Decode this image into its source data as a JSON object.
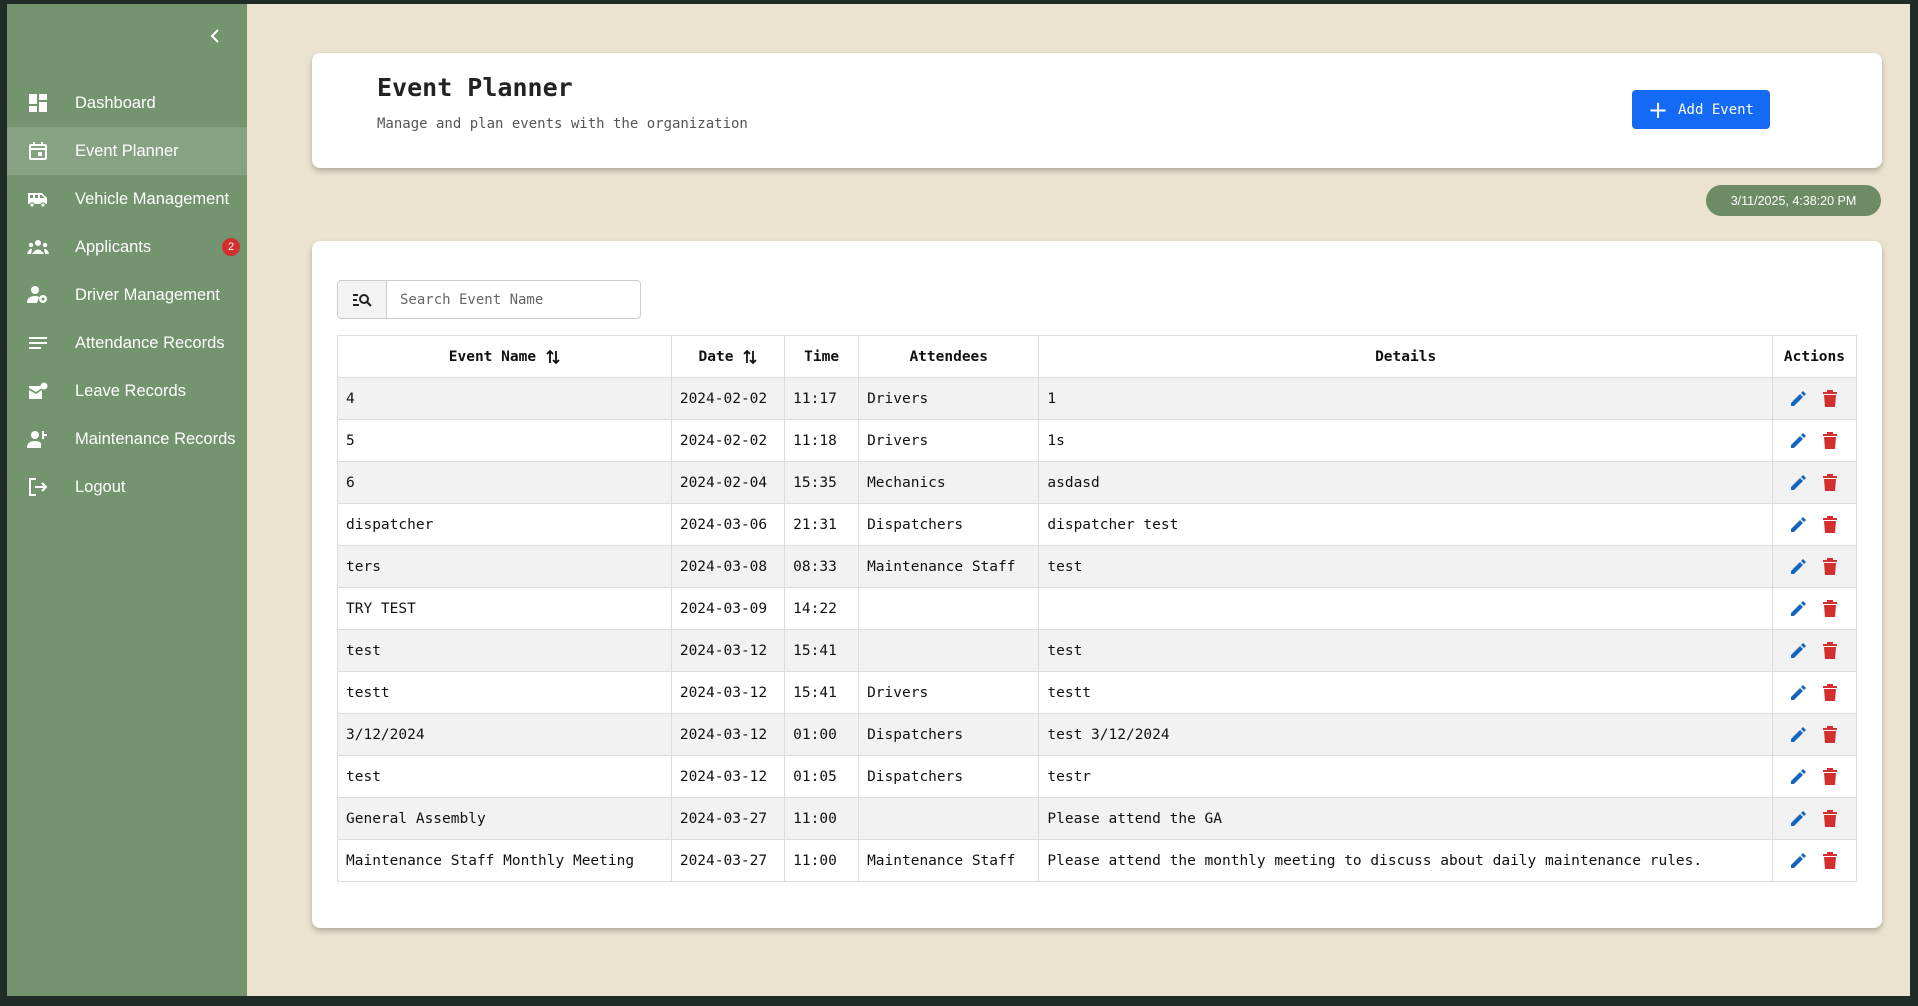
{
  "sidebar": {
    "items": [
      {
        "label": "Dashboard",
        "icon": "dashboard-icon"
      },
      {
        "label": "Event Planner",
        "icon": "calendar-icon",
        "active": true
      },
      {
        "label": "Vehicle Management",
        "icon": "bus-icon"
      },
      {
        "label": "Applicants",
        "icon": "groups-icon",
        "badge": "2"
      },
      {
        "label": "Driver Management",
        "icon": "user-gear-icon"
      },
      {
        "label": "Attendance Records",
        "icon": "list-icon"
      },
      {
        "label": "Leave Records",
        "icon": "mail-icon"
      },
      {
        "label": "Maintenance Records",
        "icon": "user-wrench-icon"
      },
      {
        "label": "Logout",
        "icon": "logout-icon"
      }
    ]
  },
  "header": {
    "title": "Event Planner",
    "subtitle": "Manage and plan events with the organization",
    "add_button_label": "Add Event"
  },
  "timestamp": "3/11/2025, 4:38:20 PM",
  "search": {
    "placeholder": "Search Event Name",
    "value": ""
  },
  "table": {
    "columns": [
      "Event Name",
      "Date",
      "Time",
      "Attendees",
      "Details",
      "Actions"
    ],
    "rows": [
      {
        "name": "4",
        "date": "2024-02-02",
        "time": "11:17",
        "attendees": "Drivers",
        "details": "1"
      },
      {
        "name": "5",
        "date": "2024-02-02",
        "time": "11:18",
        "attendees": "Drivers",
        "details": "1s"
      },
      {
        "name": "6",
        "date": "2024-02-04",
        "time": "15:35",
        "attendees": "Mechanics",
        "details": "asdasd"
      },
      {
        "name": "dispatcher",
        "date": "2024-03-06",
        "time": "21:31",
        "attendees": "Dispatchers",
        "details": "dispatcher test"
      },
      {
        "name": "ters",
        "date": "2024-03-08",
        "time": "08:33",
        "attendees": "Maintenance Staff",
        "details": "test"
      },
      {
        "name": "TRY TEST",
        "date": "2024-03-09",
        "time": "14:22",
        "attendees": "",
        "details": ""
      },
      {
        "name": "test",
        "date": "2024-03-12",
        "time": "15:41",
        "attendees": "",
        "details": "test"
      },
      {
        "name": "testt",
        "date": "2024-03-12",
        "time": "15:41",
        "attendees": "Drivers",
        "details": "testt"
      },
      {
        "name": "3/12/2024",
        "date": "2024-03-12",
        "time": "01:00",
        "attendees": "Dispatchers",
        "details": "test 3/12/2024"
      },
      {
        "name": "test",
        "date": "2024-03-12",
        "time": "01:05",
        "attendees": "Dispatchers",
        "details": "testr"
      },
      {
        "name": "General Assembly",
        "date": "2024-03-27",
        "time": "11:00",
        "attendees": "",
        "details": "Please attend the GA"
      },
      {
        "name": "Maintenance Staff Monthly Meeting",
        "date": "2024-03-27",
        "time": "11:00",
        "attendees": "Maintenance Staff",
        "details": "Please attend the monthly meeting to discuss about daily maintenance rules."
      }
    ]
  },
  "colors": {
    "sidebar": "#74946f",
    "sidebar_active": "#87a283",
    "background": "#ebe3cf",
    "primary_button": "#1469f5",
    "edit_icon": "#1565c0",
    "delete_icon": "#d32f2f",
    "badge": "#d32f2f",
    "timestamp_pill": "#6d8c66"
  }
}
